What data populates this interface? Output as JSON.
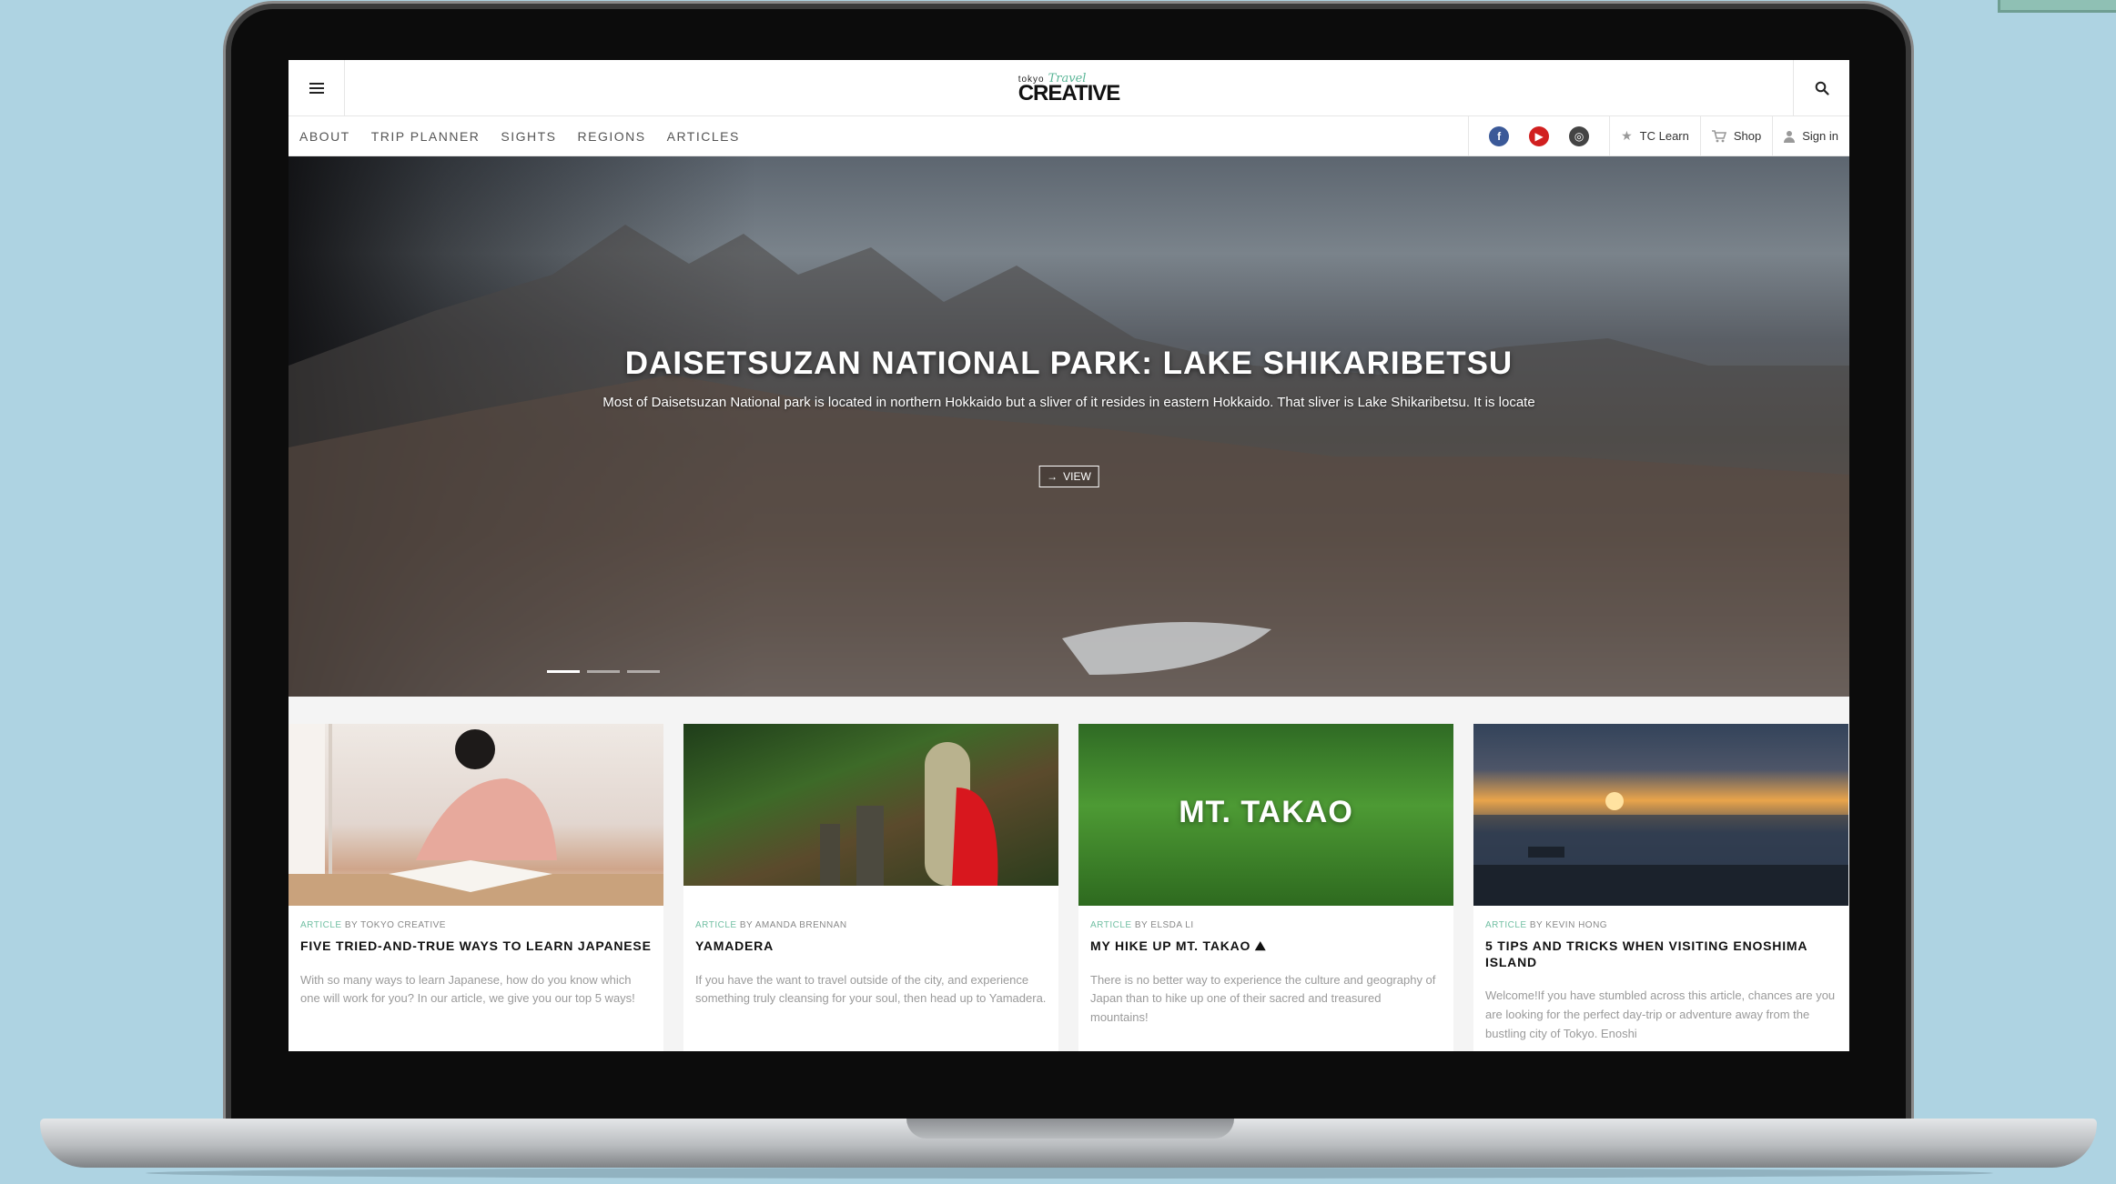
{
  "site": {
    "logo_small": "tokyo",
    "logo_script": "Travel",
    "logo_main": "CREATIVE"
  },
  "nav": {
    "items": [
      "ABOUT",
      "TRIP PLANNER",
      "SIGHTS",
      "REGIONS",
      "ARTICLES"
    ],
    "tc_learn": "TC Learn",
    "shop": "Shop",
    "sign_in": "Sign in"
  },
  "hero": {
    "title": "DAISETSUZAN NATIONAL PARK: LAKE SHIKARIBETSU",
    "description": "Most of Daisetsuzan National park is located in northern Hokkaido but a sliver of it resides in eastern Hokkaido. That sliver is Lake Shikaribetsu. It is locate",
    "button_label": "VIEW",
    "slide_count": 3,
    "active_slide": 1
  },
  "cards": [
    {
      "tag": "ARTICLE",
      "byline": " BY TOKYO CREATIVE",
      "title": "FIVE TRIED-AND-TRUE WAYS TO LEARN JAPANESE",
      "text": "With so many ways to learn Japanese, how do you know which one will work for you? In our article, we give you our top 5 ways!"
    },
    {
      "tag": "ARTICLE",
      "byline": " BY AMANDA BRENNAN",
      "title": "YAMADERA",
      "text": "If you have the want to travel outside of the city, and experience something truly cleansing for your soul, then head up to Yamadera."
    },
    {
      "tag": "ARTICLE",
      "byline": " BY ELSDA LI",
      "title": "MY HIKE UP MT. TAKAO ⛰",
      "image_text": "MT. TAKAO",
      "text": "There is no better way to experience the culture and geography of Japan than to hike up one of their sacred and treasured mountains!"
    },
    {
      "tag": "ARTICLE",
      "byline": " BY KEVIN HONG",
      "title": "5 TIPS AND TRICKS WHEN VISITING ENOSHIMA ISLAND",
      "text": "Welcome!If you have stumbled across this article, chances are you are looking for the perfect day-trip or adventure away from the bustling city of Tokyo. Enoshi"
    }
  ]
}
